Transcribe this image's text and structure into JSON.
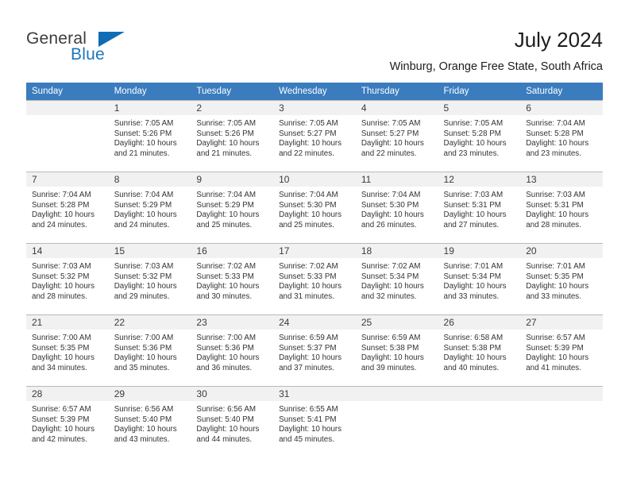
{
  "brand": {
    "word_one": "General",
    "word_two": "Blue",
    "flag_icon": "triangle-flag-icon",
    "color_primary": "#0f6cb5",
    "color_text": "#3c3c3c"
  },
  "header": {
    "title": "July 2024",
    "location": "Winburg, Orange Free State, South Africa"
  },
  "calendar": {
    "header_bg": "#3a7cbe",
    "daynum_bg": "#f1f1f1",
    "weekdays": [
      "Sunday",
      "Monday",
      "Tuesday",
      "Wednesday",
      "Thursday",
      "Friday",
      "Saturday"
    ],
    "weeks": [
      [
        {
          "day": "",
          "lines": []
        },
        {
          "day": "1",
          "lines": [
            "Sunrise: 7:05 AM",
            "Sunset: 5:26 PM",
            "Daylight: 10 hours",
            "and 21 minutes."
          ]
        },
        {
          "day": "2",
          "lines": [
            "Sunrise: 7:05 AM",
            "Sunset: 5:26 PM",
            "Daylight: 10 hours",
            "and 21 minutes."
          ]
        },
        {
          "day": "3",
          "lines": [
            "Sunrise: 7:05 AM",
            "Sunset: 5:27 PM",
            "Daylight: 10 hours",
            "and 22 minutes."
          ]
        },
        {
          "day": "4",
          "lines": [
            "Sunrise: 7:05 AM",
            "Sunset: 5:27 PM",
            "Daylight: 10 hours",
            "and 22 minutes."
          ]
        },
        {
          "day": "5",
          "lines": [
            "Sunrise: 7:05 AM",
            "Sunset: 5:28 PM",
            "Daylight: 10 hours",
            "and 23 minutes."
          ]
        },
        {
          "day": "6",
          "lines": [
            "Sunrise: 7:04 AM",
            "Sunset: 5:28 PM",
            "Daylight: 10 hours",
            "and 23 minutes."
          ]
        }
      ],
      [
        {
          "day": "7",
          "lines": [
            "Sunrise: 7:04 AM",
            "Sunset: 5:28 PM",
            "Daylight: 10 hours",
            "and 24 minutes."
          ]
        },
        {
          "day": "8",
          "lines": [
            "Sunrise: 7:04 AM",
            "Sunset: 5:29 PM",
            "Daylight: 10 hours",
            "and 24 minutes."
          ]
        },
        {
          "day": "9",
          "lines": [
            "Sunrise: 7:04 AM",
            "Sunset: 5:29 PM",
            "Daylight: 10 hours",
            "and 25 minutes."
          ]
        },
        {
          "day": "10",
          "lines": [
            "Sunrise: 7:04 AM",
            "Sunset: 5:30 PM",
            "Daylight: 10 hours",
            "and 25 minutes."
          ]
        },
        {
          "day": "11",
          "lines": [
            "Sunrise: 7:04 AM",
            "Sunset: 5:30 PM",
            "Daylight: 10 hours",
            "and 26 minutes."
          ]
        },
        {
          "day": "12",
          "lines": [
            "Sunrise: 7:03 AM",
            "Sunset: 5:31 PM",
            "Daylight: 10 hours",
            "and 27 minutes."
          ]
        },
        {
          "day": "13",
          "lines": [
            "Sunrise: 7:03 AM",
            "Sunset: 5:31 PM",
            "Daylight: 10 hours",
            "and 28 minutes."
          ]
        }
      ],
      [
        {
          "day": "14",
          "lines": [
            "Sunrise: 7:03 AM",
            "Sunset: 5:32 PM",
            "Daylight: 10 hours",
            "and 28 minutes."
          ]
        },
        {
          "day": "15",
          "lines": [
            "Sunrise: 7:03 AM",
            "Sunset: 5:32 PM",
            "Daylight: 10 hours",
            "and 29 minutes."
          ]
        },
        {
          "day": "16",
          "lines": [
            "Sunrise: 7:02 AM",
            "Sunset: 5:33 PM",
            "Daylight: 10 hours",
            "and 30 minutes."
          ]
        },
        {
          "day": "17",
          "lines": [
            "Sunrise: 7:02 AM",
            "Sunset: 5:33 PM",
            "Daylight: 10 hours",
            "and 31 minutes."
          ]
        },
        {
          "day": "18",
          "lines": [
            "Sunrise: 7:02 AM",
            "Sunset: 5:34 PM",
            "Daylight: 10 hours",
            "and 32 minutes."
          ]
        },
        {
          "day": "19",
          "lines": [
            "Sunrise: 7:01 AM",
            "Sunset: 5:34 PM",
            "Daylight: 10 hours",
            "and 33 minutes."
          ]
        },
        {
          "day": "20",
          "lines": [
            "Sunrise: 7:01 AM",
            "Sunset: 5:35 PM",
            "Daylight: 10 hours",
            "and 33 minutes."
          ]
        }
      ],
      [
        {
          "day": "21",
          "lines": [
            "Sunrise: 7:00 AM",
            "Sunset: 5:35 PM",
            "Daylight: 10 hours",
            "and 34 minutes."
          ]
        },
        {
          "day": "22",
          "lines": [
            "Sunrise: 7:00 AM",
            "Sunset: 5:36 PM",
            "Daylight: 10 hours",
            "and 35 minutes."
          ]
        },
        {
          "day": "23",
          "lines": [
            "Sunrise: 7:00 AM",
            "Sunset: 5:36 PM",
            "Daylight: 10 hours",
            "and 36 minutes."
          ]
        },
        {
          "day": "24",
          "lines": [
            "Sunrise: 6:59 AM",
            "Sunset: 5:37 PM",
            "Daylight: 10 hours",
            "and 37 minutes."
          ]
        },
        {
          "day": "25",
          "lines": [
            "Sunrise: 6:59 AM",
            "Sunset: 5:38 PM",
            "Daylight: 10 hours",
            "and 39 minutes."
          ]
        },
        {
          "day": "26",
          "lines": [
            "Sunrise: 6:58 AM",
            "Sunset: 5:38 PM",
            "Daylight: 10 hours",
            "and 40 minutes."
          ]
        },
        {
          "day": "27",
          "lines": [
            "Sunrise: 6:57 AM",
            "Sunset: 5:39 PM",
            "Daylight: 10 hours",
            "and 41 minutes."
          ]
        }
      ],
      [
        {
          "day": "28",
          "lines": [
            "Sunrise: 6:57 AM",
            "Sunset: 5:39 PM",
            "Daylight: 10 hours",
            "and 42 minutes."
          ]
        },
        {
          "day": "29",
          "lines": [
            "Sunrise: 6:56 AM",
            "Sunset: 5:40 PM",
            "Daylight: 10 hours",
            "and 43 minutes."
          ]
        },
        {
          "day": "30",
          "lines": [
            "Sunrise: 6:56 AM",
            "Sunset: 5:40 PM",
            "Daylight: 10 hours",
            "and 44 minutes."
          ]
        },
        {
          "day": "31",
          "lines": [
            "Sunrise: 6:55 AM",
            "Sunset: 5:41 PM",
            "Daylight: 10 hours",
            "and 45 minutes."
          ]
        },
        {
          "day": "",
          "lines": []
        },
        {
          "day": "",
          "lines": []
        },
        {
          "day": "",
          "lines": []
        }
      ]
    ]
  }
}
